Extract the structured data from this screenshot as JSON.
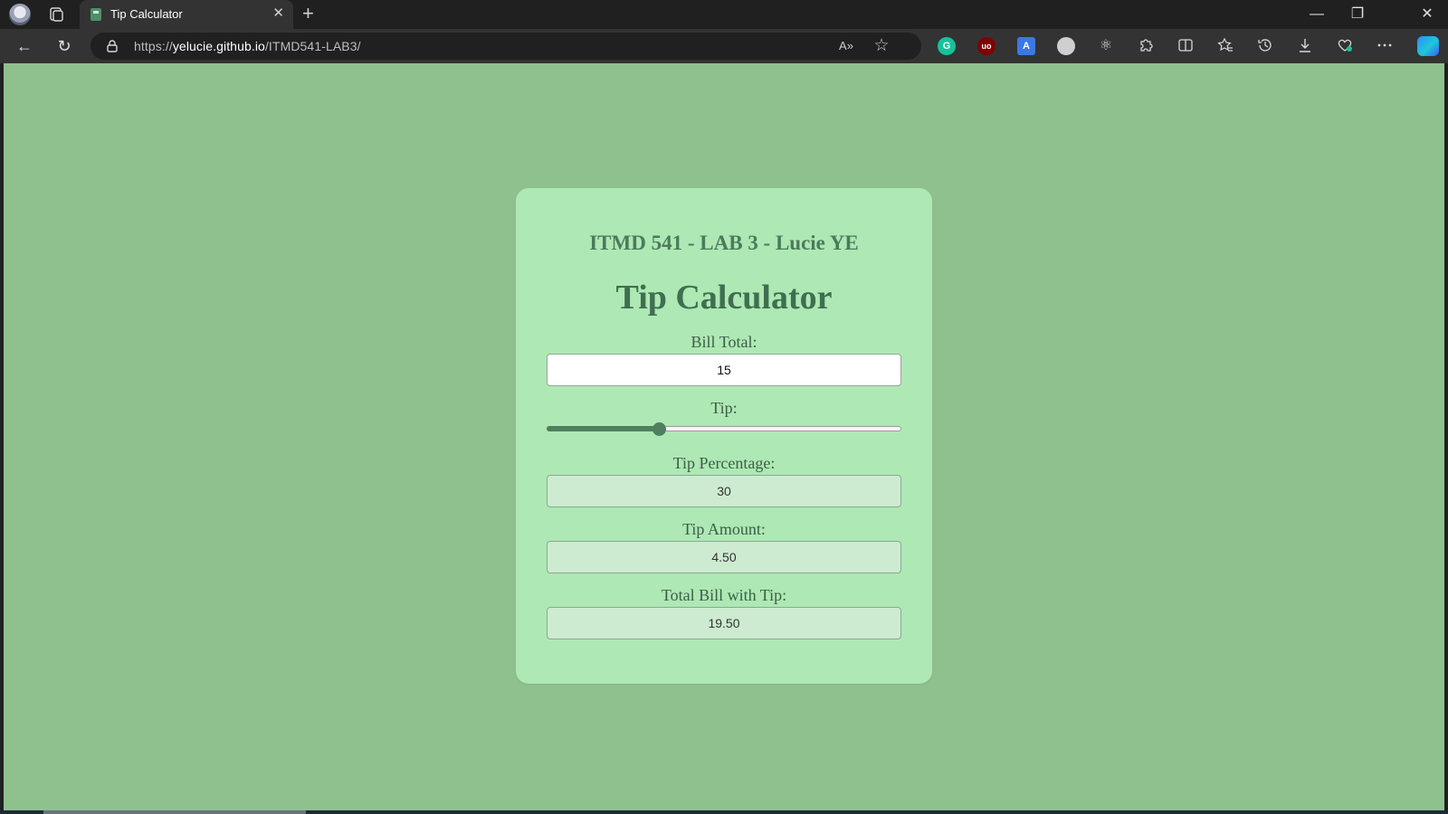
{
  "browser": {
    "tab": {
      "title": "Tip Calculator",
      "close": "✕"
    },
    "new_tab": "+",
    "window": {
      "minimize": "—",
      "restore": "❐",
      "close": "✕"
    },
    "nav": {
      "back": "←",
      "refresh": "↻"
    },
    "address": {
      "scheme": "https://",
      "host": "yelucie.github.io",
      "path": "/ITMD541-LAB3/"
    },
    "omnibox_icons": {
      "read_aloud": "A»",
      "favorite": "☆"
    },
    "extensions": [
      {
        "name": "grammarly-icon",
        "glyph": "G",
        "color": "#15c39a"
      },
      {
        "name": "ublock-icon",
        "glyph": "uo",
        "color": "#800000"
      },
      {
        "name": "translate-icon",
        "glyph": "A",
        "color": "#3b78e7"
      },
      {
        "name": "circle-extension-icon",
        "glyph": "",
        "color": "#cfcfcf"
      },
      {
        "name": "react-devtools-icon",
        "glyph": "⚛",
        "color": ""
      }
    ],
    "toolbar_icons": [
      "puzzle-icon",
      "split-screen-icon",
      "favorites-icon",
      "history-icon",
      "downloads-icon",
      "performance-icon",
      "more-icon"
    ]
  },
  "page": {
    "subtitle": "ITMD 541 - LAB 3 - Lucie YE",
    "title": "Tip Calculator",
    "bill": {
      "label": "Bill Total:",
      "value": "15"
    },
    "tip": {
      "label": "Tip:",
      "slider_fraction": 0.31
    },
    "tip_percentage": {
      "label": "Tip Percentage:",
      "value": "30"
    },
    "tip_amount": {
      "label": "Tip Amount:",
      "value": "4.50"
    },
    "total": {
      "label": "Total Bill with Tip:",
      "value": "19.50"
    }
  },
  "colors": {
    "background": "#8fc18f",
    "card": "#aee8b4",
    "accent": "#4f7f5c"
  }
}
